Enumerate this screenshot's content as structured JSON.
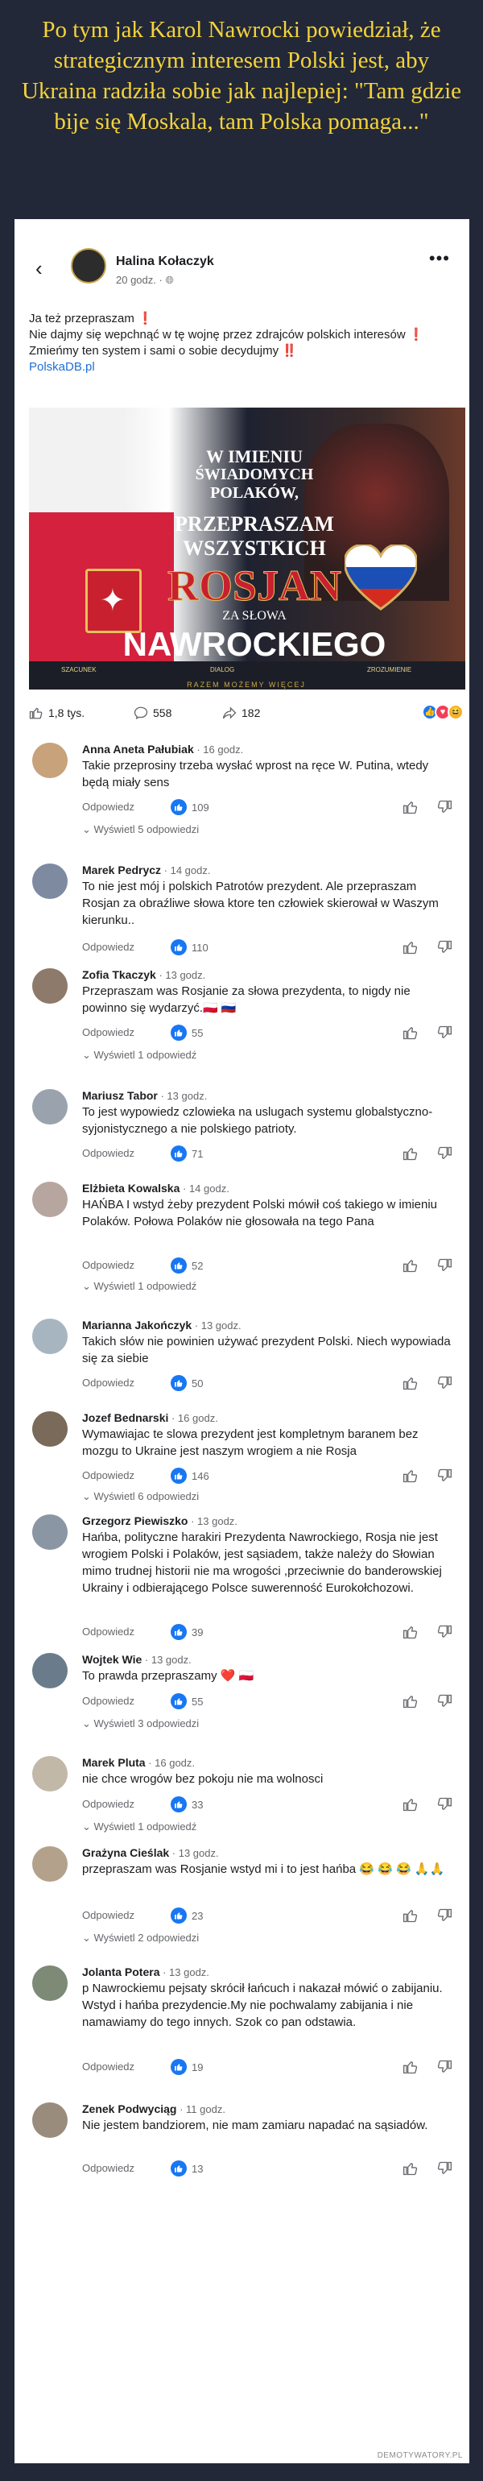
{
  "headline": "Po tym jak Karol Nawrocki powiedział, że strategicznym interesem Polski jest, aby Ukraina radziła sobie jak najlepiej: \"Tam gdzie bije się Moskala, tam Polska pomaga...\"",
  "post": {
    "author": "Halina Kołaczyk",
    "meta": "20 godz. · ",
    "text_line1": "Ja też przepraszam ❗",
    "text_line2": "Nie dajmy się wepchnąć w tę wojnę przez zdrajców polskich interesów ❗",
    "text_line3": "Zmieńmy ten system i sami o sobie decydujmy ‼️",
    "link": "PolskaDB.pl"
  },
  "image": {
    "line1": "W IMIENIU",
    "line2": "ŚWIADOMYCH POLAKÓW,",
    "line3": "PRZEPRASZAM",
    "line4": "WSZYSTKICH",
    "line5": "ROSJAN",
    "line6": "ZA SŁOWA",
    "line7": "NAWROCKIEGO",
    "pill1": "SZACUNEK",
    "pill2": "DIALOG",
    "pill3": "ZROZUMIENIE",
    "motto": "RAZEM MOŻEMY WIĘCEJ"
  },
  "stats": {
    "likes": "1,8 tys.",
    "comments": "558",
    "shares": "182"
  },
  "comments": [
    {
      "name": "Anna Aneta Pałubiak",
      "time": " · 16 godz.",
      "text": "Takie przeprosiny trzeba wysłać wprost na ręce W. Putina, wtedy będą miały sens",
      "reply": "Odpowiedz",
      "likes": "109",
      "replies": "Wyświetl 5 odpowiedzi"
    },
    {
      "name": "Marek Pedrycz",
      "time": " · 14 godz.",
      "text": "To nie jest mój i polskich Patrotów prezydent. Ale przepraszam Rosjan za obraźliwe  słowa ktore ten człowiek skierował w Waszym kierunku..",
      "reply": "Odpowiedz",
      "likes": "110",
      "replies": ""
    },
    {
      "name": "Zofia Tkaczyk",
      "time": " · 13 godz.",
      "text": "Przepraszam was  Rosjanie za słowa  prezydenta, to nigdy nie powinno się wydarzyć.🇵🇱 🇷🇺",
      "reply": "Odpowiedz",
      "likes": "55",
      "replies": "Wyświetl 1 odpowiedź"
    },
    {
      "name": "Mariusz Tabor",
      "time": " · 13 godz.",
      "text": "To jest wypowiedz czlowieka na uslugach systemu globalstyczno-syjonistycznego a nie polskiego patrioty.",
      "reply": "Odpowiedz",
      "likes": "71",
      "replies": ""
    },
    {
      "name": "Elżbieta Kowalska",
      "time": " · 14 godz.",
      "text": "HAŃBA I wstyd żeby prezydent Polski mówił coś takiego w imieniu Polaków. Połowa Polaków nie głosowała na tego Pana",
      "reply": "Odpowiedz",
      "likes": "52",
      "replies": "Wyświetl 1 odpowiedź"
    },
    {
      "name": "Marianna Jakończyk",
      "time": " · 13 godz.",
      "text": "Takich słów nie powinien używać prezydent Polski. Niech wypowiada się za siebie",
      "reply": "Odpowiedz",
      "likes": "50",
      "replies": ""
    },
    {
      "name": "Jozef Bednarski",
      "time": " · 16 godz.",
      "text": "Wymawiajac te slowa prezydent jest kompletnym baranem bez mozgu to Ukraine jest naszym wrogiem a nie Rosja",
      "reply": "Odpowiedz",
      "likes": "146",
      "replies": "Wyświetl 6 odpowiedzi"
    },
    {
      "name": "Grzegorz Piewiszko",
      "time": " · 13 godz.",
      "text": "Hańba, polityczne harakiri Prezydenta Nawrockiego, Rosja nie jest wrogiem Polski i Polaków, jest sąsiadem, także należy do Słowian mimo trudnej historii nie ma wrogości ,przeciwnie do banderowskiej Ukrainy i odbierającego Polsce suwerenność Eurokołchozowi.",
      "reply": "Odpowiedz",
      "likes": "39",
      "replies": ""
    },
    {
      "name": "Wojtek Wie",
      "time": " · 13 godz.",
      "text": "To prawda przepraszamy ❤️ 🇵🇱",
      "reply": "Odpowiedz",
      "likes": "55",
      "replies": "Wyświetl 3 odpowiedzi"
    },
    {
      "name": "Marek Pluta",
      "time": " · 16 godz.",
      "text": "nie chce wrogów bez pokoju nie ma wolnosci",
      "reply": "Odpowiedz",
      "likes": "33",
      "replies": "Wyświetl 1 odpowiedź"
    },
    {
      "name": "Grażyna Cieślak",
      "time": " · 13 godz.",
      "text": "przepraszam was Rosjanie wstyd mi i to jest hańba 😂 😂 😂 🙏🙏",
      "reply": "Odpowiedz",
      "likes": "23",
      "replies": "Wyświetl 2 odpowiedzi"
    },
    {
      "name": "Jolanta Potera",
      "time": " · 13 godz.",
      "text": "p Nawrockiemu pejsaty skrócił łańcuch i nakazał mówić o zabijaniu. Wstyd i hańba prezydencie.My nie pochwalamy zabijania i nie namawiamy do tego innych. Szok co pan odstawia.",
      "reply": "Odpowiedz",
      "likes": "19",
      "replies": ""
    },
    {
      "name": "Zenek Podwyciąg",
      "time": " · 11 godz.",
      "text": "Nie jestem bandziorem, nie mam zamiaru napadać na sąsiadów.",
      "reply": "Odpowiedz",
      "likes": "13",
      "replies": ""
    }
  ],
  "watermark": "DEMOTYWATORY.PL"
}
